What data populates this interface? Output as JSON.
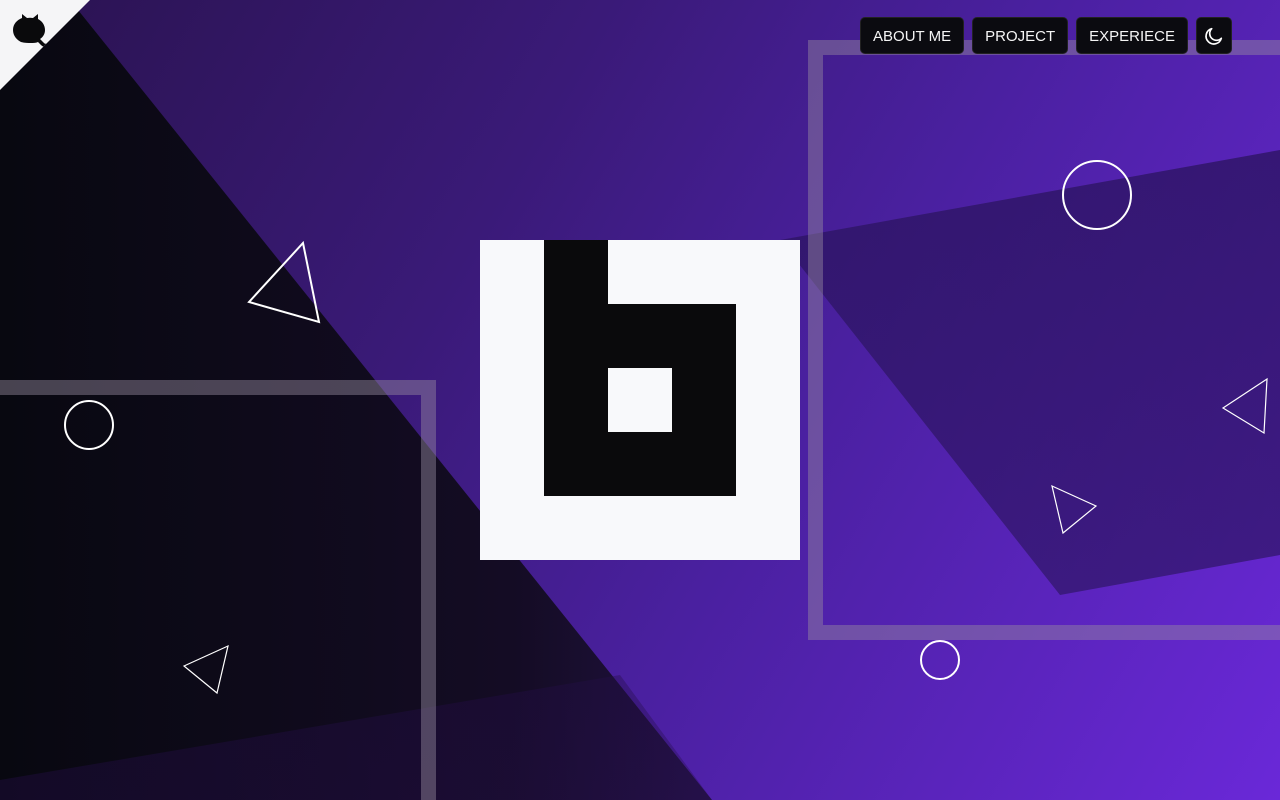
{
  "nav": {
    "about_label": "ABOUT ME",
    "project_label": "PROJECT",
    "experience_label": "EXPERIECE",
    "theme_toggle_icon": "moon-icon"
  },
  "corner": {
    "icon": "github-octocat-icon"
  },
  "logo": {
    "icon": "b-logo-mark"
  },
  "colors": {
    "accent": "#6a28d8",
    "dark": "#0a0a0c",
    "light": "#f8f9fb"
  }
}
